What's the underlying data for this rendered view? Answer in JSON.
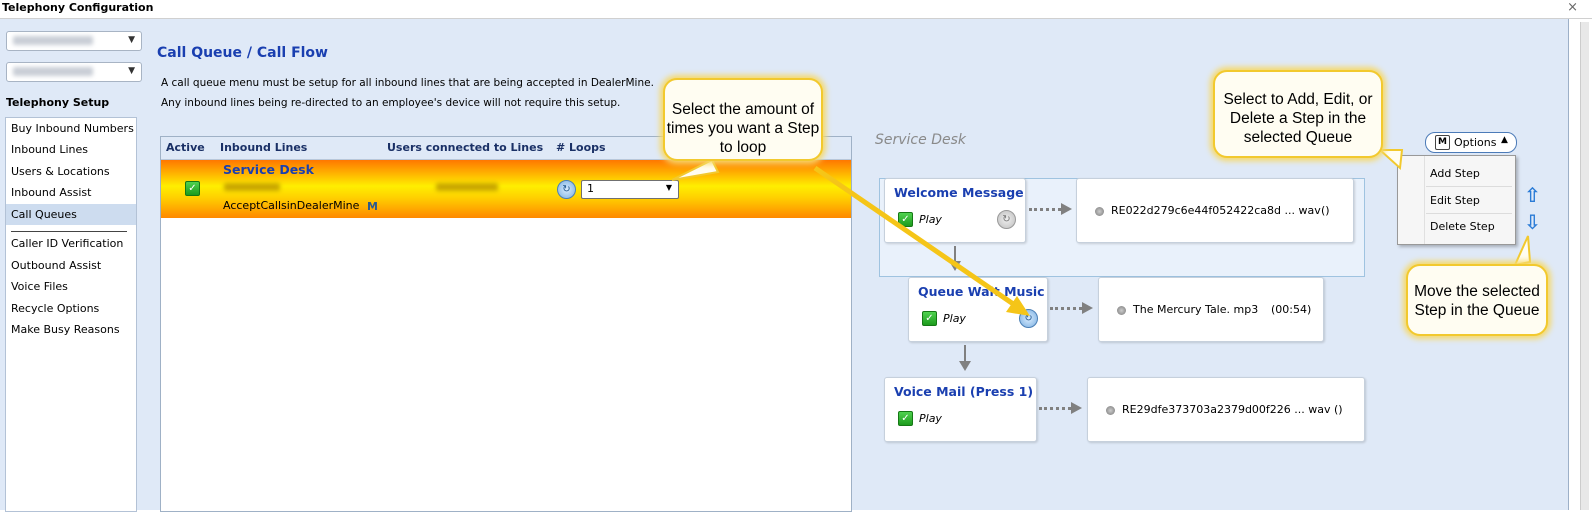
{
  "window": {
    "title": "Telephony Configuration",
    "close_glyph": "×"
  },
  "sidebar": {
    "title": "Telephony Setup",
    "items": [
      "Buy Inbound Numbers",
      "Inbound Lines",
      "Users & Locations",
      "Inbound Assist",
      "Call Queues",
      "Caller ID Verification",
      "Outbound Assist",
      "Voice Files",
      "Recycle Options",
      "Make Busy Reasons"
    ],
    "selected": "Call Queues"
  },
  "page": {
    "title": "Call Queue / Call Flow",
    "desc1": "A call queue menu must be setup for all inbound lines that are being accepted in DealerMine.",
    "desc2": "Any inbound lines being re-directed to an employee's device will not require this setup."
  },
  "table": {
    "headers": {
      "active": "Active",
      "inbound": "Inbound Lines",
      "users": "Users connected to Lines",
      "loops": "# Loops"
    },
    "row": {
      "name": "Service Desk",
      "accept": "AcceptCallsinDealerMine",
      "loops_value": "1",
      "active": true
    }
  },
  "callouts": {
    "loops": "Select the amount of times you want a Step to loop",
    "options": "Select to Add, Edit, or Delete a Step in the selected Queue",
    "move": "Move the selected Step in the Queue"
  },
  "flow": {
    "title": "Service Desk",
    "steps": [
      {
        "name": "Welcome Message",
        "action": "Play",
        "file": "RE022d279c6e44f052422ca8d ... wav",
        "duration": "()"
      },
      {
        "name": "Queue Wait Music",
        "action": "Play",
        "file": "The Mercury Tale. mp3",
        "duration": "(00:54)"
      },
      {
        "name": "Voice Mail (Press 1)",
        "action": "Play",
        "file": "RE29dfe373703a2379d00f226 ... wav",
        "duration": "()"
      }
    ]
  },
  "options": {
    "label": "Options",
    "menu": [
      "Add Step",
      "Edit Step",
      "Delete Step"
    ]
  },
  "colors": {
    "accent": "#1a3fb0",
    "row_highlight": "#ffd000",
    "callout_border": "#f2c92e",
    "move_arrow": "#2a7bd6"
  },
  "icons": [
    "close-icon",
    "chevron-down-icon",
    "checkbox-checked-icon",
    "loop-icon",
    "options-icon",
    "arrow-up-icon",
    "arrow-down-icon",
    "audio-file-icon"
  ]
}
